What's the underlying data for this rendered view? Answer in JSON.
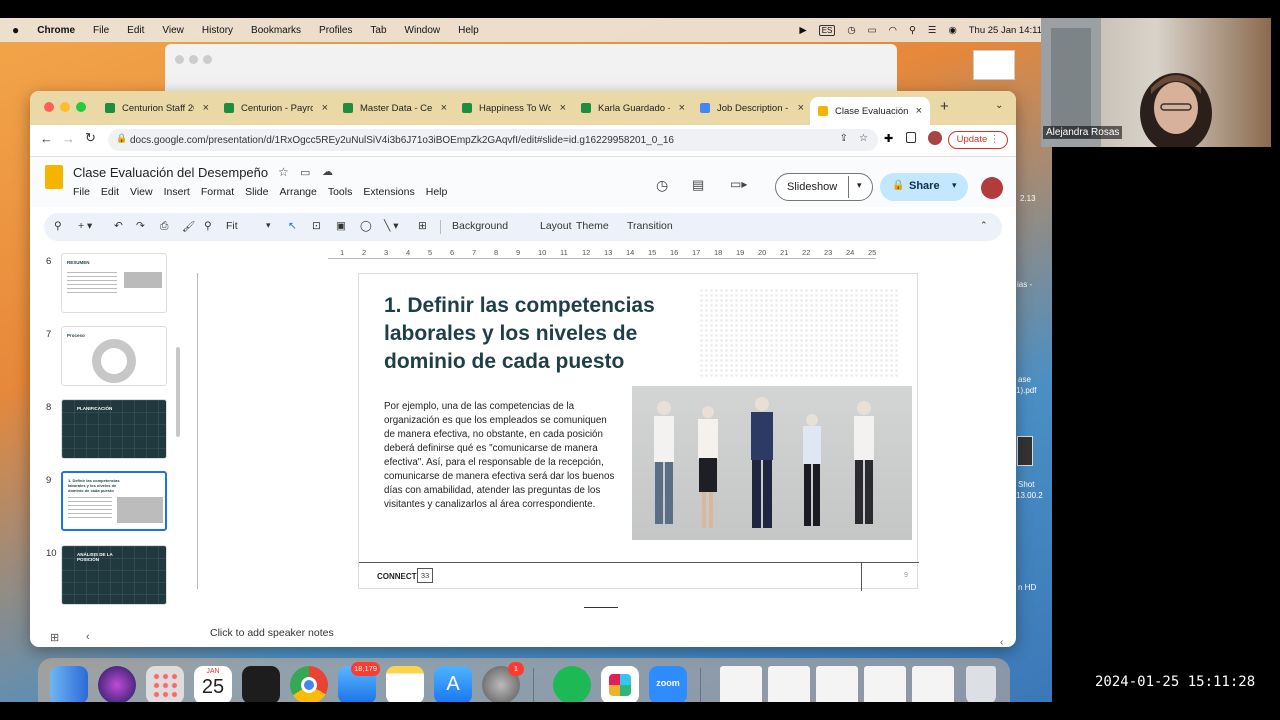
{
  "menubar": {
    "apple": "",
    "items": [
      "Chrome",
      "File",
      "Edit",
      "View",
      "History",
      "Bookmarks",
      "Profiles",
      "Tab",
      "Window",
      "Help"
    ],
    "input_source": "ES",
    "clock": "Thu 25 Jan  14:11"
  },
  "tabs": [
    {
      "label": "Centurion Staff 20",
      "icon": "sheets"
    },
    {
      "label": "Centurion - Payro",
      "icon": "sheets"
    },
    {
      "label": "Master Data - Cer",
      "icon": "sheets"
    },
    {
      "label": "Happiness To Wo",
      "icon": "sheets"
    },
    {
      "label": "Karla Guardado -",
      "icon": "sheets"
    },
    {
      "label": "Job Description -",
      "icon": "docs"
    },
    {
      "label": "Clase Evaluación",
      "icon": "slides"
    }
  ],
  "omnibox": {
    "url": "docs.google.com/presentation/d/1RxOgcc5REy2uNulSiV4i3b6J71o3iBOEmpZk2GAqvfI/edit#slide=id.g16229958201_0_16",
    "update_label": "Update"
  },
  "doc": {
    "title": "Clase Evaluación del Desempeño",
    "menu": [
      "File",
      "Edit",
      "View",
      "Insert",
      "Format",
      "Slide",
      "Arrange",
      "Tools",
      "Extensions",
      "Help"
    ],
    "slideshow_label": "Slideshow",
    "share_label": "Share"
  },
  "toolbar": {
    "zoom": "Fit",
    "background": "Background",
    "layout": "Layout",
    "theme": "Theme",
    "transition": "Transition"
  },
  "ruler": [
    "1",
    "2",
    "3",
    "4",
    "5",
    "6",
    "7",
    "8",
    "9",
    "10",
    "11",
    "12",
    "13",
    "14",
    "15",
    "16",
    "17",
    "18",
    "19",
    "20",
    "21",
    "22",
    "23",
    "24",
    "25"
  ],
  "filmstrip": [
    {
      "num": "6",
      "title": "RESUMEN",
      "dark": false
    },
    {
      "num": "7",
      "title": "Proceso",
      "dark": false
    },
    {
      "num": "8",
      "title": "PLANIFICACIÓN",
      "dark": true
    },
    {
      "num": "9",
      "title": "1. Definir las competencias laborales y los niveles de dominio de cada puesto",
      "dark": false
    },
    {
      "num": "10",
      "title": "ANÁLISIS DE LA POSICIÓN",
      "dark": true
    }
  ],
  "slide": {
    "title": "1. Definir las competencias laborales y los niveles de dominio de cada puesto",
    "body": "Por ejemplo, una de las competencias de la organización es que los empleados se comuniquen de manera efectiva, no obstante, en cada posición deberá definirse qué es \"comunicarse de manera efectiva\". Así, para el responsable de la recepción, comunicarse de manera efectiva será dar los buenos días con amabilidad, atender las preguntas de los visitantes y canalizarlos al área correspondiente.",
    "footer_brand": "CONNECT",
    "footer_mark": "33",
    "page_number": "9"
  },
  "notes_placeholder": "Click to add speaker notes",
  "dock": {
    "calendar_month": "JAN",
    "calendar_day": "25",
    "mail_badge": "18,179",
    "settings_badge": "1",
    "zoom_label": "zoom"
  },
  "desktop_items": [
    "2.13",
    "ias -",
    "ase",
    "1).pdf",
    "Shot",
    "13.00.2",
    "n HD"
  ],
  "zoom_participant": "Alejandra Rosas",
  "timestamp": "2024-01-25  15:11:28"
}
